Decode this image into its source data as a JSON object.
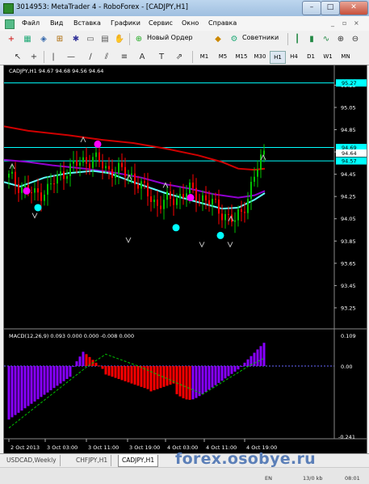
{
  "window": {
    "title": "3014953: MetaTrader 4 - RoboForex - [CADJPY,H1]",
    "minimize": "–",
    "maximize": "□",
    "close": "✕"
  },
  "menu": [
    "Файл",
    "Вид",
    "Вставка",
    "Графики",
    "Сервис",
    "Окно",
    "Справка"
  ],
  "toolbar": {
    "new_order": "Новый Ордер",
    "advisors": "Советники"
  },
  "timeframes": [
    "M1",
    "M5",
    "M15",
    "M30",
    "H1",
    "H4",
    "D1",
    "W1",
    "MN"
  ],
  "active_timeframe": "H1",
  "main_panel": {
    "header": "CADJPY,H1  94.67 94.68 94.56 94.64",
    "price_scale": [
      "95.25",
      "95.05",
      "94.85",
      "94.65",
      "94.45",
      "94.25",
      "94.05",
      "93.85",
      "93.65",
      "93.45",
      "93.25"
    ],
    "badges": [
      {
        "text": "95.27",
        "price": 95.27,
        "color": "#00ffff"
      },
      {
        "text": "94.69",
        "price": 94.69,
        "color": "#00ffff"
      },
      {
        "text": "94.64",
        "price": 94.64,
        "color": "#ffffff"
      },
      {
        "text": "94.57",
        "price": 94.57,
        "color": "#00ffff"
      }
    ]
  },
  "macd_panel": {
    "header": "MACD(12,26,9) 0.093 0.000 0.000 -0.008 0.000",
    "scale": [
      "0.109",
      "0.00",
      "-0.241"
    ]
  },
  "time_axis": [
    "2 Oct 2013",
    "3 Oct 03:00",
    "3 Oct 11:00",
    "3 Oct 19:00",
    "4 Oct 03:00",
    "4 Oct 11:00",
    "4 Oct 19:00"
  ],
  "tabs": [
    "USDCAD,Weekly",
    "CHFJPY,H1",
    "CADJPY,H1"
  ],
  "active_tab": "CADJPY,H1",
  "status": {
    "language": "EN",
    "traffic": "13/0 kb",
    "time": "08:01"
  },
  "watermark": "forex.osobye.ru",
  "colors": {
    "bull": "#00c000",
    "bear": "#ff0000",
    "ma_red": "#d00000",
    "ma_purple": "#9000d0",
    "ma_cyan": "#60ffff",
    "macd_up": "#8800ff",
    "macd_down": "#ff0000",
    "dot_magenta": "#ff00ff",
    "dot_cyan": "#00ffff"
  }
}
